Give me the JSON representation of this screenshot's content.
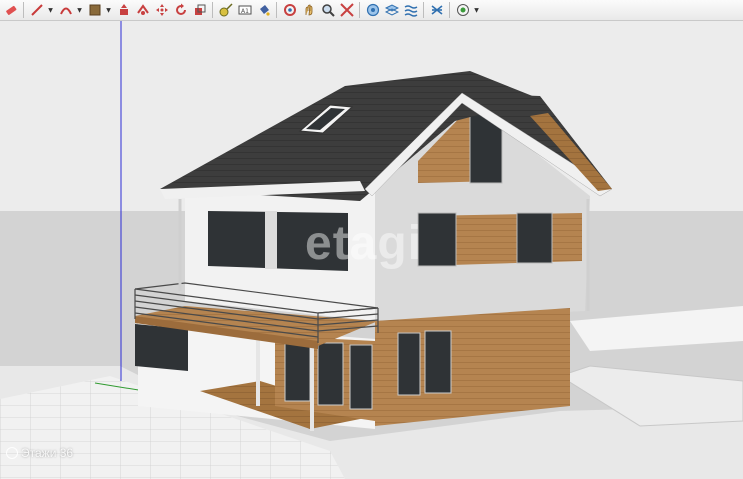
{
  "toolbar": {
    "buttons": [
      {
        "name": "eraser-icon",
        "color": "#d04a4a"
      },
      {
        "name": "pencil-line-icon",
        "color": "#c83a3a"
      },
      {
        "name": "arc-icon",
        "color": "#c83a3a"
      },
      {
        "name": "material-box-icon",
        "color": "#8a6a3a"
      },
      {
        "name": "push-pull-icon",
        "color": "#c84040"
      },
      {
        "name": "follow-me-icon",
        "color": "#c84040"
      },
      {
        "name": "move-icon",
        "color": "#c84040"
      },
      {
        "name": "rotate-icon",
        "color": "#c84040"
      },
      {
        "name": "scale-icon",
        "color": "#c84040"
      },
      {
        "name": "tape-measure-icon",
        "color": "#6a6a20"
      },
      {
        "name": "text-icon",
        "color": "#505050"
      },
      {
        "name": "paint-bucket-icon",
        "color": "#4060a0"
      },
      {
        "name": "orbit-icon",
        "color": "#c84040"
      },
      {
        "name": "pan-icon",
        "color": "#c8a040"
      },
      {
        "name": "zoom-icon",
        "color": "#404040"
      },
      {
        "name": "zoom-extents-icon",
        "color": "#c84040"
      },
      {
        "name": "previous-view-icon",
        "color": "#3070b0"
      },
      {
        "name": "iso-view-icon",
        "color": "#3070b0"
      },
      {
        "name": "section-plane-icon",
        "color": "#3070b0"
      },
      {
        "name": "xray-icon",
        "color": "#3070b0"
      },
      {
        "name": "style-menu-icon",
        "color": "#3a9a3a"
      }
    ]
  },
  "watermark": {
    "center_text": "etagi",
    "corner_text": "Этажи 36"
  },
  "colors": {
    "sky": "#e8e8e8",
    "ground": "#f2f2f2",
    "roof": "#3d3d3d",
    "stucco": "#d9d9d9",
    "wood": "#b58450",
    "glass": "#2f3336",
    "axis_blue": "#2b2bd6",
    "axis_green": "#2f9a2f"
  }
}
